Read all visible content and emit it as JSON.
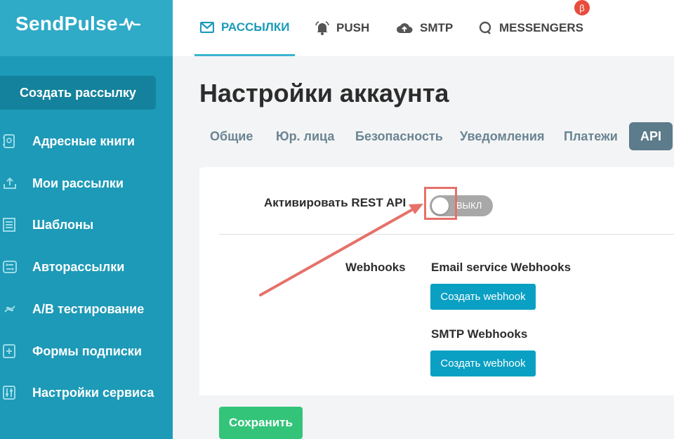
{
  "brand": {
    "logo_text": "SendPulse"
  },
  "sidebar": {
    "create_button": "Создать рассылку",
    "items": [
      {
        "label": "Адресные книги",
        "icon": "address-book-icon"
      },
      {
        "label": "Мои рассылки",
        "icon": "upload-icon"
      },
      {
        "label": "Шаблоны",
        "icon": "template-icon"
      },
      {
        "label": "Авторассылки",
        "icon": "automation-icon"
      },
      {
        "label": "A/B тестирование",
        "icon": "ab-test-icon"
      },
      {
        "label": "Формы подписки",
        "icon": "form-icon"
      },
      {
        "label": "Настройки сервиса",
        "icon": "sliders-icon"
      }
    ]
  },
  "topnav": {
    "tabs": [
      {
        "label": "РАССЫЛКИ",
        "icon": "envelope-icon",
        "active": true
      },
      {
        "label": "PUSH",
        "icon": "bell-icon"
      },
      {
        "label": "SMTP",
        "icon": "cloud-upload-icon"
      },
      {
        "label": "MESSENGERS",
        "icon": "chat-icon"
      }
    ],
    "beta_badge": "β"
  },
  "page": {
    "title": "Настройки аккаунта",
    "tabs": [
      {
        "label": "Общие"
      },
      {
        "label": "Юр. лица"
      },
      {
        "label": "Безопасность"
      },
      {
        "label": "Уведомления"
      },
      {
        "label": "Платежи"
      },
      {
        "label": "API",
        "active": true
      }
    ]
  },
  "api": {
    "rest_label": "Активировать REST API",
    "toggle_state": "ВЫКЛ",
    "webhooks_label": "Webhooks",
    "email_webhooks_title": "Email service Webhooks",
    "email_webhooks_button": "Создать webhook",
    "smtp_webhooks_title": "SMTP Webhooks",
    "smtp_webhooks_button": "Создать webhook",
    "save_button": "Сохранить"
  },
  "colors": {
    "sidebar": "#1d9ab7",
    "accent": "#1b9ab8",
    "active_tab": "#5c7b8b",
    "save": "#33c47a",
    "annotation": "#e57169"
  }
}
